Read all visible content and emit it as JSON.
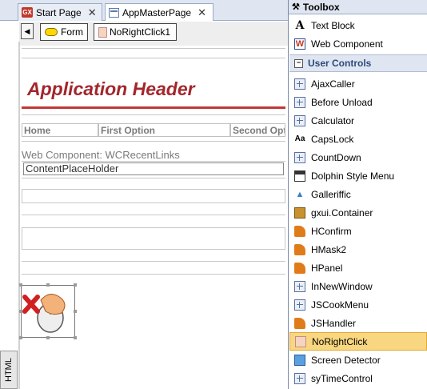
{
  "tabs": [
    {
      "label": "Start Page",
      "icon": "gx-icon"
    },
    {
      "label": "AppMasterPage",
      "icon": "page-icon"
    }
  ],
  "designer": {
    "toolbar": {
      "form_label": "Form",
      "control_label": "NoRightClick1"
    },
    "header_title": "Application Header",
    "menu": [
      "Home",
      "First Option",
      "Second Option"
    ],
    "web_component": "Web Component: WCRecentLinks",
    "content_placeholder": "ContentPlaceHolder",
    "html_tab": "HTML"
  },
  "toolbox": {
    "title": "Toolbox",
    "standard_items": [
      {
        "label": "Text Block",
        "icon": "text-block-icon"
      },
      {
        "label": "Web Component",
        "icon": "web-component-icon"
      }
    ],
    "section_label": "User Controls",
    "user_controls": [
      {
        "label": "AjaxCaller",
        "icon": "grid-icon"
      },
      {
        "label": "Before Unload",
        "icon": "grid-icon"
      },
      {
        "label": "Calculator",
        "icon": "grid-icon"
      },
      {
        "label": "CapsLock",
        "icon": "capslock-icon"
      },
      {
        "label": "CountDown",
        "icon": "grid-icon"
      },
      {
        "label": "Dolphin Style Menu",
        "icon": "menu-icon"
      },
      {
        "label": "Galleriffic",
        "icon": "bird-icon"
      },
      {
        "label": "gxui.Container",
        "icon": "folder-icon"
      },
      {
        "label": "HConfirm",
        "icon": "orange-icon"
      },
      {
        "label": "HMask2",
        "icon": "orange-icon"
      },
      {
        "label": "HPanel",
        "icon": "orange-icon"
      },
      {
        "label": "InNewWindow",
        "icon": "grid-icon"
      },
      {
        "label": "JSCookMenu",
        "icon": "grid-icon"
      },
      {
        "label": "JSHandler",
        "icon": "orange-icon"
      },
      {
        "label": "NoRightClick",
        "icon": "no-right-click-icon",
        "selected": true
      },
      {
        "label": "Screen Detector",
        "icon": "monitor-icon"
      },
      {
        "label": "syTimeControl",
        "icon": "grid-icon"
      }
    ]
  },
  "colors": {
    "header": "#a3262c",
    "selection": "#f9d780",
    "panel": "#dfe6f1"
  }
}
